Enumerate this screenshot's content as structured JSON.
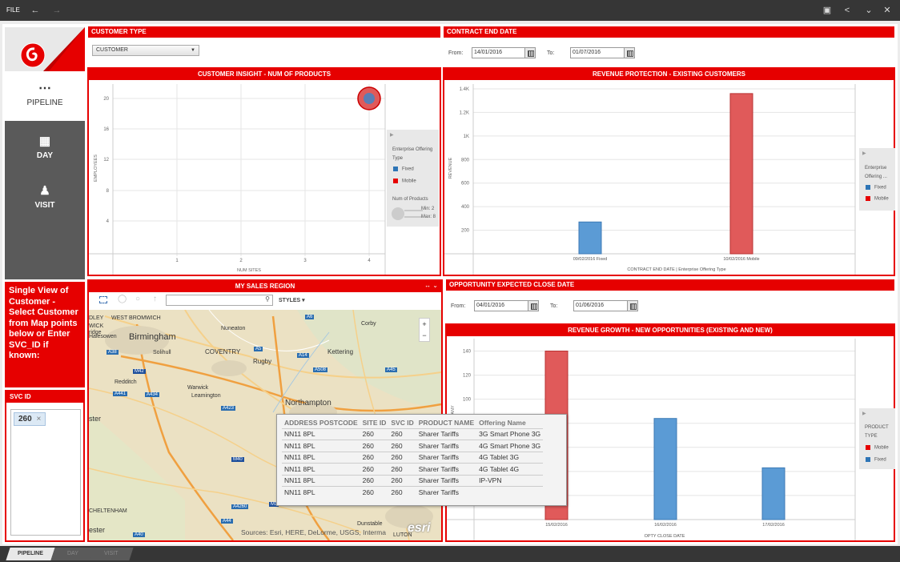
{
  "topbar": {
    "file": "FILE",
    "back_icon": "back-arrow-icon",
    "forward_icon": "forward-arrow-icon",
    "right_icons": [
      "present-icon",
      "share-icon",
      "collapse-icon",
      "close-icon"
    ]
  },
  "nav": {
    "items": [
      {
        "label": "PIPELINE",
        "icon": "pipeline-icon"
      },
      {
        "label": "DAY",
        "icon": "calendar-icon"
      },
      {
        "label": "VISIT",
        "icon": "person-icon"
      }
    ]
  },
  "info": {
    "text": "Single View of Customer - Select Customer from Map points below or Enter SVC_ID if known:"
  },
  "svc": {
    "title": "SVC ID",
    "tag": "260",
    "remove": "×"
  },
  "customer_type": {
    "title": "CUSTOMER TYPE",
    "selected": "CUSTOMER"
  },
  "contract": {
    "title": "CONTRACT END DATE",
    "from_label": "From:",
    "from": "14/01/2016",
    "to_label": "To:",
    "to": "01/07/2016"
  },
  "insight": {
    "title": "CUSTOMER INSIGHT - NUM OF PRODUCTS",
    "legend": {
      "heading": "Enterprise Offering Type",
      "items": [
        "Fixed",
        "Mobile"
      ],
      "size_heading": "Num of Products",
      "min": "Min: 2",
      "max": "Max: 8"
    }
  },
  "revenue_protection": {
    "title": "REVENUE PROTECTION - EXISTING CUSTOMERS",
    "legend": {
      "heading": "Enterprise Offering ...",
      "items": [
        "Fixed",
        "Mobile"
      ]
    }
  },
  "opportunity": {
    "title": "OPPORTUNITY EXPECTED CLOSE DATE",
    "from_label": "From:",
    "from": "04/01/2016",
    "to_label": "To:",
    "to": "01/06/2016"
  },
  "revenue_growth": {
    "title": "REVENUE GROWTH - NEW OPPORTUNITIES (EXISTING AND NEW)",
    "legend": {
      "heading": "PRODUCT TYPE",
      "items": [
        "Mobile",
        "Fixed"
      ]
    }
  },
  "map": {
    "title": "MY SALES REGION",
    "styles": "STYLES",
    "attribution": "Sources: Esri, HERE, DeLorme, USGS, Interma",
    "esri": "esri",
    "places": [
      "Birmingham",
      "Nuneaton",
      "Corby",
      "COVENTRY",
      "Kettering",
      "Rugby",
      "Solihull",
      "Warwick",
      "Leamington",
      "Redditch",
      "Northampton",
      "Halesowen",
      "DLEY",
      "WEST BROMWICH",
      "ster",
      "CHELTENHAM",
      "Dunstable",
      "LUTON",
      "ester",
      "WICK",
      "ridge"
    ],
    "roads": [
      "A6",
      "A5",
      "A14",
      "A508",
      "A45",
      "M42",
      "A38",
      "A441",
      "A434",
      "A423",
      "M40",
      "A4260",
      "A44",
      "A40",
      "M1"
    ]
  },
  "popup": {
    "headers": [
      "ADDRESS POSTCODE",
      "SITE ID",
      "SVC ID",
      "PRODUCT NAME",
      "Offering Name"
    ],
    "rows": [
      [
        "NN11 8PL",
        "260",
        "260",
        "Sharer Tariffs",
        "3G Smart Phone 3G"
      ],
      [
        "NN11 8PL",
        "260",
        "260",
        "Sharer Tariffs",
        "4G Smart Phone 3G"
      ],
      [
        "NN11 8PL",
        "260",
        "260",
        "Sharer Tariffs",
        "4G Tablet 3G"
      ],
      [
        "NN11 8PL",
        "260",
        "260",
        "Sharer Tariffs",
        "4G Tablet 4G"
      ],
      [
        "NN11 8PL",
        "260",
        "260",
        "Sharer Tariffs",
        "IP-VPN"
      ],
      [
        "NN11 8PL",
        "260",
        "260",
        "Sharer Tariffs",
        ""
      ]
    ]
  },
  "tabs": [
    "PIPELINE",
    "DAY",
    "VISIT"
  ],
  "colors": {
    "brand": "#e60000",
    "fixed": "#5b9bd5",
    "mobile": "#e05a5a"
  },
  "chart_data": [
    {
      "type": "scatter",
      "title": "CUSTOMER INSIGHT - NUM OF PRODUCTS",
      "xlabel": "NUM SITES",
      "ylabel": "EMPLOYEES",
      "x_ticks": [
        "1",
        "2",
        "3",
        "4"
      ],
      "y_ticks": [
        "4",
        "8",
        "12",
        "16",
        "20"
      ],
      "points": [
        {
          "x": 4,
          "y": 20,
          "size": 8,
          "series": "Mobile"
        }
      ]
    },
    {
      "type": "bar",
      "title": "REVENUE PROTECTION - EXISTING CUSTOMERS",
      "xlabel": "CONTRACT END DATE  |  Enterprise Offering Type",
      "ylabel": "REVENUE",
      "y_ticks": [
        "200",
        "400",
        "600",
        "800",
        "1K",
        "1.2K",
        "1.4K"
      ],
      "ylim": [
        0,
        1400
      ],
      "categories": [
        "09/02/2016 Fixed",
        "10/02/2016 Mobile"
      ],
      "values": [
        270,
        1360
      ],
      "series": [
        "Fixed",
        "Mobile"
      ]
    },
    {
      "type": "bar",
      "title": "REVENUE GROWTH - NEW OPPORTUNITIES (EXISTING AND NEW)",
      "xlabel": "OPTY CLOSE DATE",
      "ylabel": "COMPANY",
      "y_ticks": [
        "100",
        "120",
        "140"
      ],
      "ylim": [
        0,
        145
      ],
      "categories": [
        "15/02/2016",
        "16/02/2016",
        "17/02/2016"
      ],
      "values": [
        140,
        84,
        43
      ],
      "series": [
        "Mobile",
        "Fixed",
        "Fixed"
      ]
    }
  ]
}
